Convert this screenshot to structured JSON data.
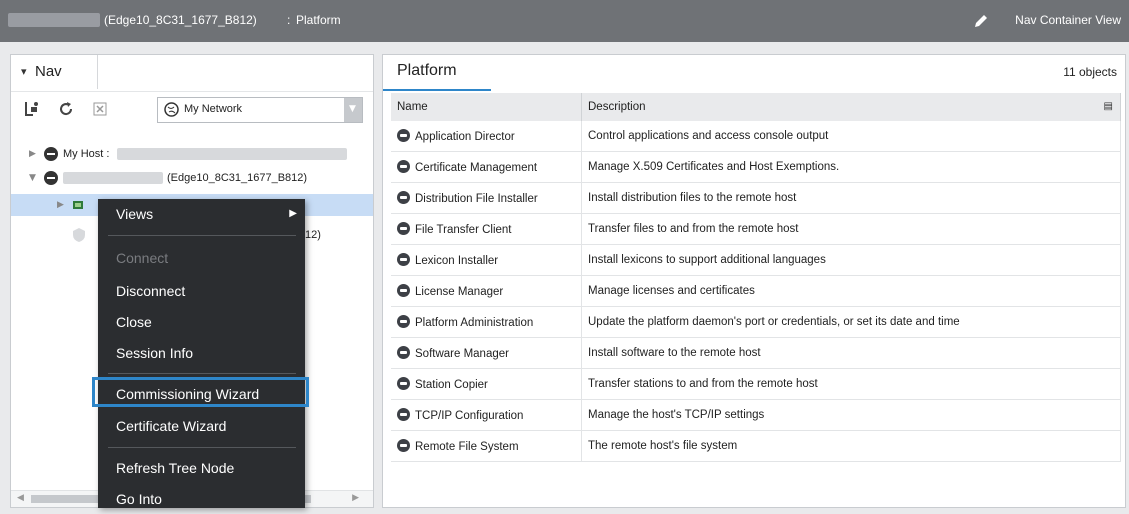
{
  "topbar": {
    "host_label": "(Edge10_8C31_1677_B812)",
    "separator": ":",
    "platform_label": "Platform",
    "view_label": "Nav Container View"
  },
  "nav": {
    "tab_label": "Nav",
    "network_select": "My Network",
    "tree": [
      {
        "label": "My Host :"
      },
      {
        "label": "(Edge10_8C31_1677_B812)"
      },
      {
        "label": ""
      },
      {
        "label": "12)"
      }
    ]
  },
  "context_menu": {
    "items": [
      "Views",
      "Connect",
      "Disconnect",
      "Close",
      "Session Info",
      "Commissioning Wizard",
      "Certificate Wizard",
      "Refresh Tree Node",
      "Go Into"
    ],
    "highlight_color": "#2e86c9"
  },
  "platform": {
    "tab_label": "Platform",
    "object_count": "11 objects",
    "columns": [
      "Name",
      "Description"
    ],
    "rows": [
      {
        "name": "Application Director",
        "desc": "Control applications and access console output"
      },
      {
        "name": "Certificate Management",
        "desc": "Manage X.509 Certificates and Host Exemptions."
      },
      {
        "name": "Distribution File Installer",
        "desc": "Install distribution files to the remote host"
      },
      {
        "name": "File Transfer Client",
        "desc": "Transfer files to and from the remote host"
      },
      {
        "name": "Lexicon Installer",
        "desc": "Install lexicons to support additional languages"
      },
      {
        "name": "License Manager",
        "desc": "Manage licenses and certificates"
      },
      {
        "name": "Platform Administration",
        "desc": "Update the platform daemon's port or credentials, or set its date and time"
      },
      {
        "name": "Software Manager",
        "desc": "Install software to the remote host"
      },
      {
        "name": "Station Copier",
        "desc": "Transfer stations to and from the remote host"
      },
      {
        "name": "TCP/IP Configuration",
        "desc": "Manage the host's TCP/IP settings"
      },
      {
        "name": "Remote File System",
        "desc": "The remote host's file system"
      }
    ]
  }
}
